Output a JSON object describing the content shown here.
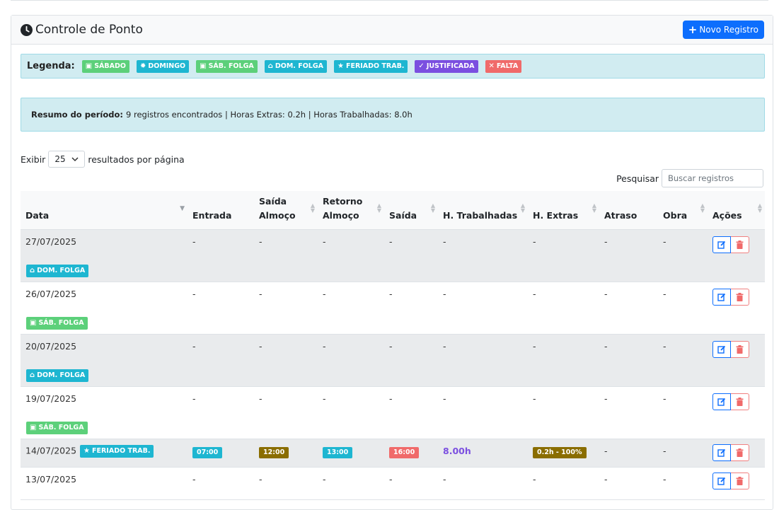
{
  "colors": {
    "sabado": "#5cd07a",
    "domingo": "#1eb6d1",
    "sab_folga": "#5cd07a",
    "dom_folga": "#1eb6d1",
    "feriado_trab": "#1eb6d1",
    "justificada": "#7b4fe0",
    "falta": "#f06a6a",
    "time_blue": "#1eb6d1",
    "time_brown": "#8a6d00",
    "time_red": "#f06a6a",
    "primary": "#0d6efd"
  },
  "header": {
    "title": "Controle de Ponto",
    "icon": "clock-icon",
    "new_button": "Novo Registro"
  },
  "legend": {
    "label": "Legenda:",
    "items": [
      {
        "label": "SÁBADO",
        "icon": "calendar-icon"
      },
      {
        "label": "DOMINGO",
        "icon": "sun-icon"
      },
      {
        "label": "SÁB. FOLGA",
        "icon": "calendar-icon"
      },
      {
        "label": "DOM. FOLGA",
        "icon": "home-icon"
      },
      {
        "label": "FERIADO TRAB.",
        "icon": "star-icon"
      },
      {
        "label": "JUSTIFICADA",
        "icon": "check-icon"
      },
      {
        "label": "FALTA",
        "icon": "x-icon"
      }
    ]
  },
  "summary": {
    "label": "Resumo do período:",
    "text": "9 registros encontrados | Horas Extras: 0.2h | Horas Trabalhadas: 8.0h"
  },
  "length_menu": {
    "prefix": "Exibir",
    "value": "25",
    "suffix": "resultados por página"
  },
  "search": {
    "label": "Pesquisar",
    "placeholder": "Buscar registros"
  },
  "table": {
    "columns": [
      {
        "l1": "",
        "l2": "Data"
      },
      {
        "l1": "",
        "l2": "Entrada"
      },
      {
        "l1": "Saída",
        "l2": "Almoço"
      },
      {
        "l1": "Retorno",
        "l2": "Almoço"
      },
      {
        "l1": "",
        "l2": "Saída"
      },
      {
        "l1": "",
        "l2": "H. Trabalhadas"
      },
      {
        "l1": "",
        "l2": "H. Extras"
      },
      {
        "l1": "",
        "l2": "Atraso"
      },
      {
        "l1": "",
        "l2": "Obra"
      },
      {
        "l1": "",
        "l2": "Ações"
      }
    ],
    "empty": "-",
    "rows": [
      {
        "date": "27/07/2025",
        "badge": "DOM. FOLGA"
      },
      {
        "date": "26/07/2025",
        "badge": "SÁB. FOLGA"
      },
      {
        "date": "20/07/2025",
        "badge": "DOM. FOLGA"
      },
      {
        "date": "19/07/2025",
        "badge": "SÁB. FOLGA"
      },
      {
        "date": "14/07/2025",
        "badge": "FERIADO TRAB.",
        "entrada": "07:00",
        "saida_almoco": "12:00",
        "retorno_almoco": "13:00",
        "saida": "16:00",
        "horas": "8.00h",
        "extras": "0.2h - 100%"
      },
      {
        "date": "13/07/2025",
        "badge": ""
      }
    ]
  }
}
